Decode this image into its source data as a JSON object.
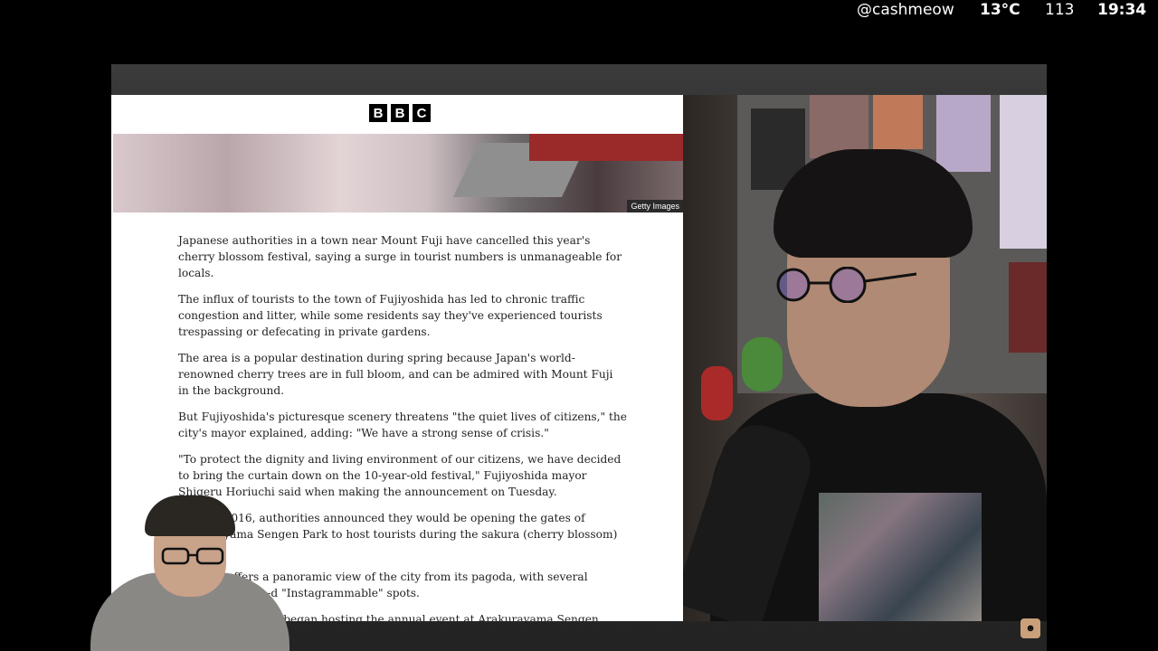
{
  "status": {
    "handle": "@cashmeow",
    "temperature": "13°C",
    "count": "113",
    "time": "19:34"
  },
  "article": {
    "logo_letters": [
      "B",
      "B",
      "C"
    ],
    "image_credit": "Getty Images",
    "paragraphs": [
      "Japanese authorities in a town near Mount Fuji have cancelled this year's cherry blossom festival, saying a surge in tourist numbers is unmanageable for locals.",
      "The influx of tourists to the town of Fujiyoshida has led to chronic traffic congestion and litter, while some residents say they've experienced tourists trespassing or defecating in private gardens.",
      "The area is a popular destination during spring because Japan's world-renowned cherry trees are in full bloom, and can be admired with Mount Fuji in the background.",
      "But Fujiyoshida's picturesque scenery threatens \"the quiet lives of citizens,\" the city's mayor explained, adding: \"We have a strong sense of crisis.\"",
      "\"To protect the dignity and living environment of our citizens, we have decided to bring the curtain down on the 10-year-old festival,\" Fujiyoshida mayor Shigeru Horiuchi said when making the announcement on Tuesday.",
      "In April 2016, authorities announced they would be opening the gates of Arakurayama Sengen Park to host tourists during the sakura (cherry blossom) season.",
      "offers a panoramic view of the city from its pagoda, with several picture-d \"Instagrammable\" spots.",
      "a authorities began hosting the annual event at Arakurayama Sengen Park e to enhance the area's appeal and increase the numbers of visitors by atmosphere in the area\"."
    ]
  },
  "colors": {
    "frame_bg": "#2b2b2b",
    "article_bg": "#ffffff",
    "text": "#222222"
  }
}
